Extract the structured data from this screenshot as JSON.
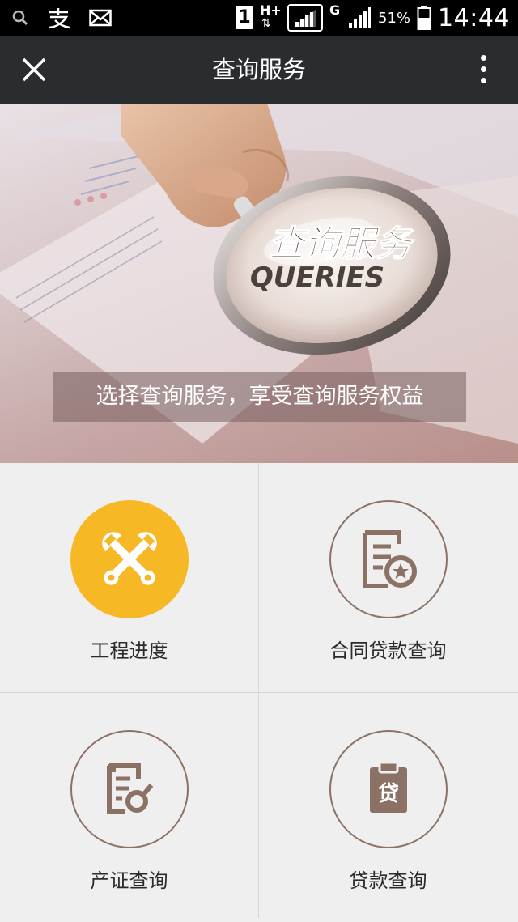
{
  "status_bar": {
    "left_icons": [
      "search-icon",
      "alipay-icon",
      "mail-icon"
    ],
    "sim_indicator": "1",
    "network_hplus": "H+",
    "network_g": "G",
    "battery": "51%",
    "time": "14:44"
  },
  "nav": {
    "title": "查询服务",
    "close_icon": "close-icon",
    "more_icon": "more-vertical-icon"
  },
  "banner": {
    "title": "查询服务",
    "title_en": "QUERIES",
    "subtitle": "选择查询服务，享受查询服务权益"
  },
  "services": [
    {
      "label": "工程进度",
      "icon": "wrench-cross-icon",
      "accent": "#f6b825"
    },
    {
      "label": "合同贷款查询",
      "icon": "contract-document-icon",
      "accent": "#8b7264"
    },
    {
      "label": "产证查询",
      "icon": "certificate-search-icon",
      "accent": "#8b7264"
    },
    {
      "label": "贷款查询",
      "icon": "loan-clipboard-icon",
      "accent": "#8b7264"
    }
  ],
  "colors": {
    "nav_bg": "#2a2d2f",
    "accent_yellow": "#f6b825",
    "icon_brown": "#8b7264"
  }
}
